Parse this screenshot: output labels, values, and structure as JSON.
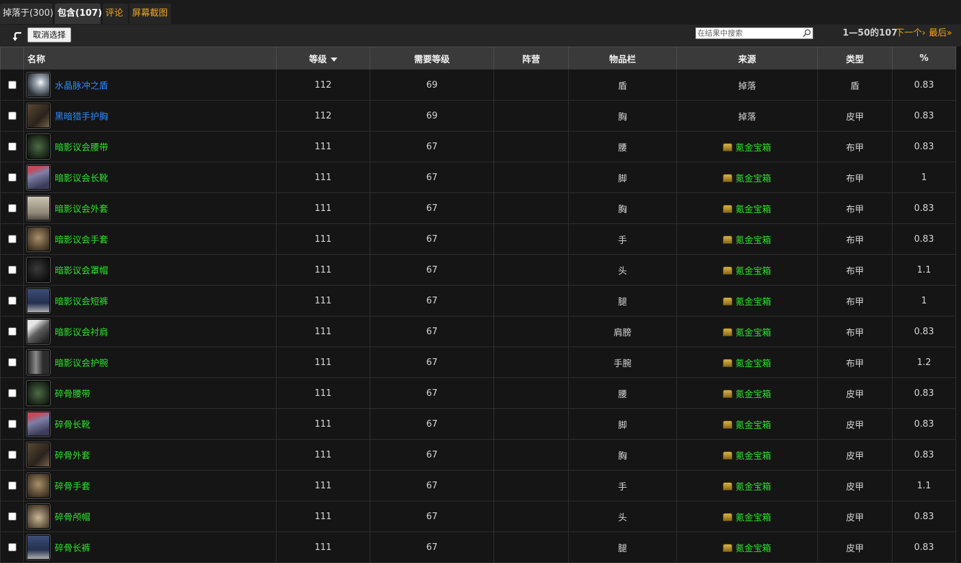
{
  "tabs": [
    {
      "label": "掉落于(300)"
    },
    {
      "label": "包含(107)"
    },
    {
      "label": "评论"
    },
    {
      "label": "屏幕截图"
    }
  ],
  "toolbar": {
    "back_icon": "back-arrow-icon",
    "deselect_label": "取消选择",
    "search_placeholder": "在结果中搜索",
    "pager_range": "1—50的107",
    "pager_next": "下一个›",
    "pager_last": "最后»"
  },
  "colors": {
    "rare": "#2e88ff",
    "uncommon": "#2ee32e",
    "accent": "#f2a51a"
  },
  "table": {
    "headers": {
      "name": "名称",
      "level": "等级",
      "req_level": "需要等级",
      "faction": "阵营",
      "slot": "物品栏",
      "source": "来源",
      "type": "类型",
      "percent": "%"
    },
    "rows": [
      {
        "name": "水晶脉冲之盾",
        "quality": "rare",
        "icon": "crystal-shield-icon",
        "level": "112",
        "req": "69",
        "faction": "",
        "slot": "盾",
        "source": "掉落",
        "source_kind": "drop",
        "type": "盾",
        "pct": "0.83"
      },
      {
        "name": "黑暗猎手护胸",
        "quality": "rare",
        "icon": "chest-armor-icon",
        "level": "112",
        "req": "69",
        "faction": "",
        "slot": "胸",
        "source": "掉落",
        "source_kind": "drop",
        "type": "皮甲",
        "pct": "0.83"
      },
      {
        "name": "暗影议会腰带",
        "quality": "uncommon",
        "icon": "belt-icon",
        "level": "111",
        "req": "67",
        "faction": "",
        "slot": "腰",
        "source": "氪金宝箱",
        "source_kind": "box",
        "type": "布甲",
        "pct": "0.83"
      },
      {
        "name": "暗影议会长靴",
        "quality": "uncommon",
        "icon": "boots-icon",
        "level": "111",
        "req": "67",
        "faction": "",
        "slot": "脚",
        "source": "氪金宝箱",
        "source_kind": "box",
        "type": "布甲",
        "pct": "1"
      },
      {
        "name": "暗影议会外套",
        "quality": "uncommon",
        "icon": "robe-icon",
        "level": "111",
        "req": "67",
        "faction": "",
        "slot": "胸",
        "source": "氪金宝箱",
        "source_kind": "box",
        "type": "布甲",
        "pct": "0.83"
      },
      {
        "name": "暗影议会手套",
        "quality": "uncommon",
        "icon": "gloves-icon",
        "level": "111",
        "req": "67",
        "faction": "",
        "slot": "手",
        "source": "氪金宝箱",
        "source_kind": "box",
        "type": "布甲",
        "pct": "0.83"
      },
      {
        "name": "暗影议会罩帽",
        "quality": "uncommon",
        "icon": "hood-icon",
        "level": "111",
        "req": "67",
        "faction": "",
        "slot": "头",
        "source": "氪金宝箱",
        "source_kind": "box",
        "type": "布甲",
        "pct": "1.1"
      },
      {
        "name": "暗影议会短裤",
        "quality": "uncommon",
        "icon": "pants-icon",
        "level": "111",
        "req": "67",
        "faction": "",
        "slot": "腿",
        "source": "氪金宝箱",
        "source_kind": "box",
        "type": "布甲",
        "pct": "1"
      },
      {
        "name": "暗影议会衬肩",
        "quality": "uncommon",
        "icon": "shoulders-icon",
        "level": "111",
        "req": "67",
        "faction": "",
        "slot": "肩膀",
        "source": "氪金宝箱",
        "source_kind": "box",
        "type": "布甲",
        "pct": "0.83"
      },
      {
        "name": "暗影议会护腕",
        "quality": "uncommon",
        "icon": "bracers-icon",
        "level": "111",
        "req": "67",
        "faction": "",
        "slot": "手腕",
        "source": "氪金宝箱",
        "source_kind": "box",
        "type": "布甲",
        "pct": "1.2"
      },
      {
        "name": "碎骨腰带",
        "quality": "uncommon",
        "icon": "belt-icon",
        "level": "111",
        "req": "67",
        "faction": "",
        "slot": "腰",
        "source": "氪金宝箱",
        "source_kind": "box",
        "type": "皮甲",
        "pct": "0.83"
      },
      {
        "name": "碎骨长靴",
        "quality": "uncommon",
        "icon": "boots-icon",
        "level": "111",
        "req": "67",
        "faction": "",
        "slot": "脚",
        "source": "氪金宝箱",
        "source_kind": "box",
        "type": "皮甲",
        "pct": "0.83"
      },
      {
        "name": "碎骨外套",
        "quality": "uncommon",
        "icon": "chest-armor-icon",
        "level": "111",
        "req": "67",
        "faction": "",
        "slot": "胸",
        "source": "氪金宝箱",
        "source_kind": "box",
        "type": "皮甲",
        "pct": "0.83"
      },
      {
        "name": "碎骨手套",
        "quality": "uncommon",
        "icon": "gloves-icon",
        "level": "111",
        "req": "67",
        "faction": "",
        "slot": "手",
        "source": "氪金宝箱",
        "source_kind": "box",
        "type": "皮甲",
        "pct": "1.1"
      },
      {
        "name": "碎骨颅帽",
        "quality": "uncommon",
        "icon": "helm-icon",
        "level": "111",
        "req": "67",
        "faction": "",
        "slot": "头",
        "source": "氪金宝箱",
        "source_kind": "box",
        "type": "皮甲",
        "pct": "0.83"
      },
      {
        "name": "碎骨长裤",
        "quality": "uncommon",
        "icon": "pants-icon",
        "level": "111",
        "req": "67",
        "faction": "",
        "slot": "腿",
        "source": "氪金宝箱",
        "source_kind": "box",
        "type": "皮甲",
        "pct": "0.83"
      }
    ]
  }
}
